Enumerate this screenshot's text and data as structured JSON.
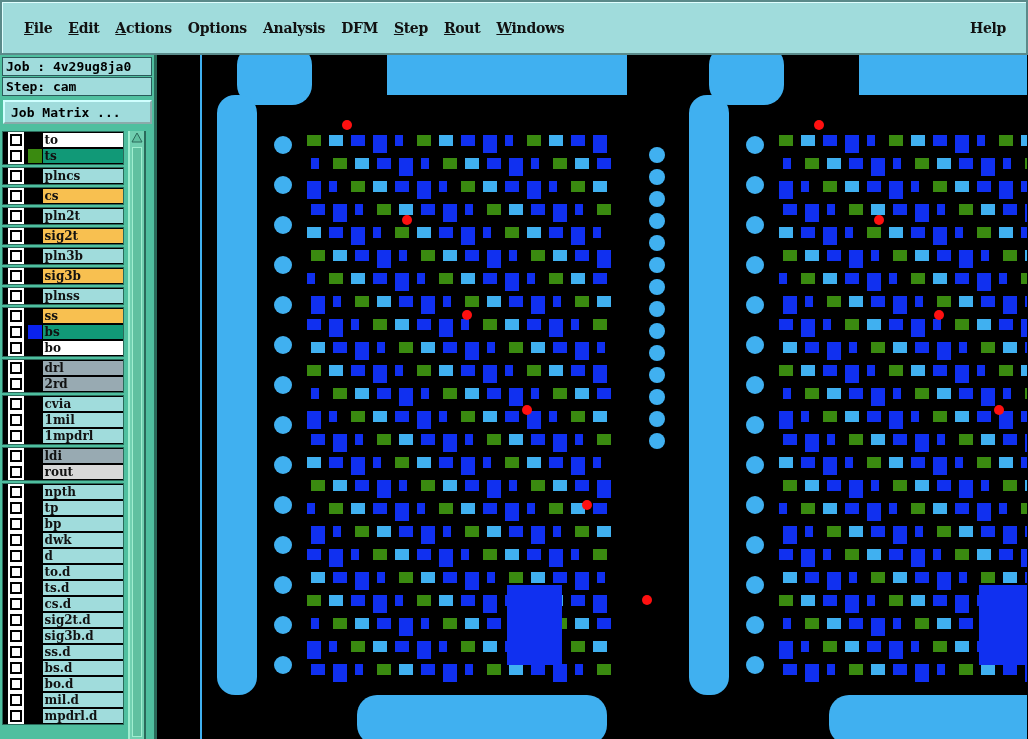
{
  "menu": [
    {
      "label": "File",
      "mnemonic": true
    },
    {
      "label": "Edit",
      "mnemonic": true
    },
    {
      "label": "Actions",
      "mnemonic": true
    },
    {
      "label": "Options",
      "mnemonic": false
    },
    {
      "label": "Analysis",
      "mnemonic": false
    },
    {
      "label": "DFM",
      "mnemonic": false
    },
    {
      "label": "Step",
      "mnemonic": true
    },
    {
      "label": "Rout",
      "mnemonic": true
    },
    {
      "label": "Windows",
      "mnemonic": true
    }
  ],
  "help": {
    "label": "Help",
    "mnemonic": false
  },
  "job": "Job : 4v29ug8ja0",
  "step": "Step: cam",
  "job_matrix_button": "Job Matrix ...",
  "layer_groups": [
    {
      "layers": [
        {
          "name": "to",
          "kind": "silk_screen",
          "checked": false,
          "shown": false
        },
        {
          "name": "ts",
          "kind": "solder_mask",
          "checked": false,
          "shown": true,
          "color": "#3a8a10"
        }
      ]
    },
    {
      "layers": [
        {
          "name": "plncs",
          "kind": "power_ground",
          "checked": false,
          "shown": false
        }
      ]
    },
    {
      "layers": [
        {
          "name": "cs",
          "kind": "signal",
          "checked": false,
          "shown": false
        }
      ]
    },
    {
      "layers": [
        {
          "name": "pln2t",
          "kind": "power_ground",
          "checked": false,
          "shown": false
        }
      ]
    },
    {
      "layers": [
        {
          "name": "sig2t",
          "kind": "signal",
          "checked": false,
          "shown": false
        }
      ]
    },
    {
      "layers": [
        {
          "name": "pln3b",
          "kind": "power_ground",
          "checked": false,
          "shown": false
        }
      ]
    },
    {
      "layers": [
        {
          "name": "sig3b",
          "kind": "signal",
          "checked": false,
          "shown": false
        }
      ]
    },
    {
      "layers": [
        {
          "name": "plnss",
          "kind": "power_ground",
          "checked": false,
          "shown": false
        }
      ]
    },
    {
      "layers": [
        {
          "name": "ss",
          "kind": "signal",
          "checked": false,
          "shown": false
        },
        {
          "name": "bs",
          "kind": "solder_mask",
          "checked": false,
          "shown": true,
          "color": "#0a22ee"
        },
        {
          "name": "bo",
          "kind": "silk_screen",
          "checked": false,
          "shown": false
        }
      ]
    },
    {
      "layers": [
        {
          "name": "drl",
          "kind": "drill",
          "checked": false,
          "shown": false
        },
        {
          "name": "2rd",
          "kind": "drill",
          "checked": false,
          "shown": false
        }
      ]
    },
    {
      "layers": [
        {
          "name": "cvia",
          "kind": "document",
          "checked": false,
          "shown": false
        },
        {
          "name": "1mil",
          "kind": "document",
          "checked": false,
          "shown": false
        },
        {
          "name": "1mpdrl",
          "kind": "document",
          "checked": false,
          "shown": false
        }
      ]
    },
    {
      "layers": [
        {
          "name": "ldi",
          "kind": "drill",
          "checked": false,
          "shown": false
        },
        {
          "name": "rout",
          "kind": "rout",
          "checked": false,
          "shown": false
        }
      ]
    },
    {
      "layers": [
        {
          "name": "npth",
          "kind": "document",
          "checked": false,
          "shown": false
        },
        {
          "name": "tp",
          "kind": "document",
          "checked": false,
          "shown": false
        },
        {
          "name": "bp",
          "kind": "document",
          "checked": false,
          "shown": false
        },
        {
          "name": "dwk",
          "kind": "document",
          "checked": false,
          "shown": false
        },
        {
          "name": "d",
          "kind": "document",
          "checked": false,
          "shown": false
        },
        {
          "name": "to.d",
          "kind": "document",
          "checked": false,
          "shown": false
        },
        {
          "name": "ts.d",
          "kind": "document",
          "checked": false,
          "shown": false
        },
        {
          "name": "cs.d",
          "kind": "document",
          "checked": false,
          "shown": false
        },
        {
          "name": "sig2t.d",
          "kind": "document",
          "checked": false,
          "shown": false
        },
        {
          "name": "sig3b.d",
          "kind": "document",
          "checked": false,
          "shown": false
        },
        {
          "name": "ss.d",
          "kind": "document",
          "checked": false,
          "shown": false
        },
        {
          "name": "bs.d",
          "kind": "document",
          "checked": false,
          "shown": false
        },
        {
          "name": "bo.d",
          "kind": "document",
          "checked": false,
          "shown": false
        },
        {
          "name": "mil.d",
          "kind": "document",
          "checked": false,
          "shown": false
        },
        {
          "name": "mpdrl.d",
          "kind": "document",
          "checked": false,
          "shown": false
        }
      ]
    }
  ]
}
